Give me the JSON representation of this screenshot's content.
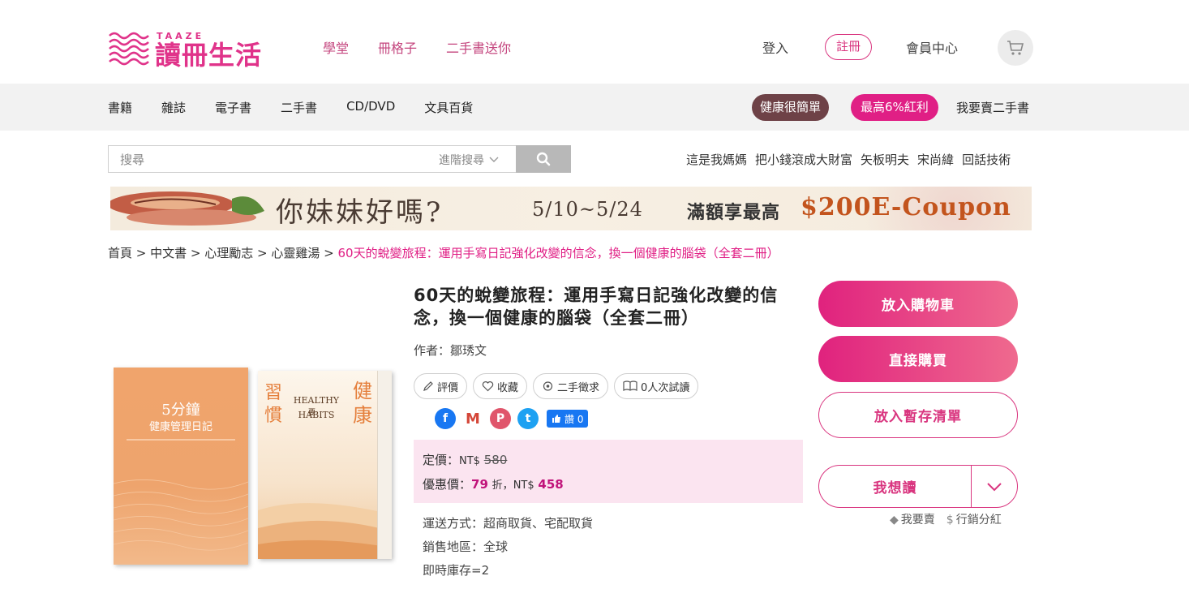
{
  "logo": {
    "en": "TAAZE",
    "zh": "讀冊生活"
  },
  "top_nav": [
    "學堂",
    "冊格子",
    "二手書送你"
  ],
  "account": {
    "login": "登入",
    "register": "註冊",
    "member_center": "會員中心"
  },
  "categories": [
    "書籍",
    "雜誌",
    "電子書",
    "二手書",
    "CD/DVD",
    "文具百貨"
  ],
  "promo_pills": {
    "health": "健康很簡單",
    "bonus": "最高6%紅利",
    "sell": "我要賣二手書"
  },
  "search": {
    "placeholder": "搜尋",
    "advanced": "進階搜尋"
  },
  "hot_keywords": [
    "這是我媽媽",
    "把小錢滾成大財富",
    "矢板明夫",
    "宋尚緯",
    "回話技術"
  ],
  "banner": {
    "handwritten": "你妹妹好嗎?",
    "dates": "5/10~5/24",
    "text": "滿額享最高",
    "coupon": "$200E-Coupon"
  },
  "breadcrumb": {
    "items": [
      "首頁",
      "中文書",
      "心理勵志",
      "心靈雞湯"
    ],
    "current": "60天的蛻變旅程：運用手寫日記強化改變的信念，換一個健康的腦袋（全套二冊）"
  },
  "product": {
    "title": "60天的蛻變旅程：運用手寫日記強化改變的信念，換一個健康的腦袋（全套二冊）",
    "author_label": "作者：",
    "author": "鄒琇文",
    "actions": {
      "review": "評價",
      "favorite": "收藏",
      "secondhand": "二手徵求",
      "trial": "0人次試讀"
    },
    "fb_share": "讚 0",
    "price": {
      "list_label": "定價：",
      "currency": "NT$",
      "list_price": "580",
      "sale_label": "優惠價：",
      "discount": "79",
      "discount_unit": "折，",
      "sale_price": "458"
    },
    "shipping": "運送方式：超商取貨、宅配取貨",
    "region": "銷售地區：全球",
    "stock": "即時庫存=2"
  },
  "buttons": {
    "add_cart": "放入購物車",
    "buy_now": "直接購買",
    "wishlist": "放入暫存清單",
    "want_read": "我想讀"
  },
  "extra_links": {
    "sell": "我要賣",
    "affiliate": "行銷分紅"
  },
  "book_covers": {
    "book1_title": "5分鐘",
    "book1_sub": "健康管理日記",
    "book2_en": "HEALTHY HABITS",
    "book2_zh1": "習慣",
    "book2_zh2": "健康",
    "book2_mid": "要"
  },
  "colors": {
    "brand": "#e0338a",
    "accent": "#e01f85",
    "price_bg": "#fbe4f0"
  }
}
